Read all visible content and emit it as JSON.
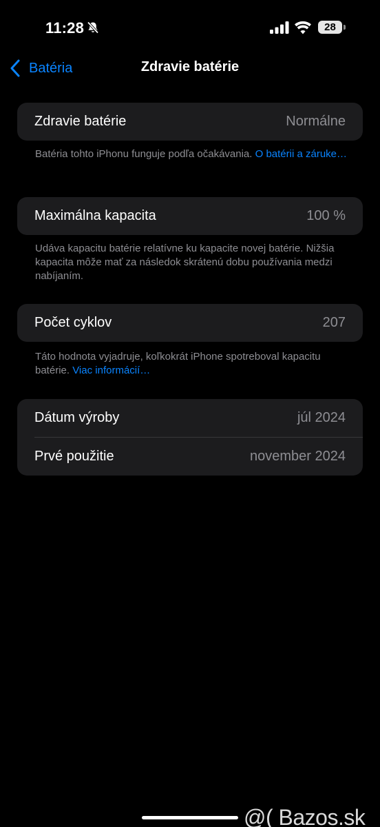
{
  "status_bar": {
    "time": "11:28",
    "battery_level": "28",
    "icons": [
      "bell-slash-icon",
      "cellular-signal-icon",
      "wifi-icon",
      "battery-icon"
    ]
  },
  "nav": {
    "back_label": "Batéria",
    "title": "Zdravie batérie"
  },
  "health": {
    "label": "Zdravie batérie",
    "value": "Normálne",
    "footnote_text": "Batéria tohto iPhonu funguje podľa očakávania. ",
    "footnote_link": "O batérii a záruke…"
  },
  "capacity": {
    "label": "Maximálna kapacita",
    "value": "100 %",
    "footnote_text": "Udáva kapacitu batérie relatívne ku kapacite novej batérie. Nižšia kapacita môže mať za následok skrátenú dobu používania medzi nabíjaním."
  },
  "cycles": {
    "label": "Počet cyklov",
    "value": "207",
    "footnote_text": "Táto hodnota vyjadruje, koľkokrát iPhone spotreboval kapacitu batérie. ",
    "footnote_link": "Viac informácií…"
  },
  "dates": {
    "manufacture_label": "Dátum výroby",
    "manufacture_value": "júl 2024",
    "first_use_label": "Prvé použitie",
    "first_use_value": "november 2024"
  },
  "watermark": "@( Bazos.sk",
  "colors": {
    "accent": "#0a84ff",
    "background": "#000000",
    "card": "#1c1c1e",
    "secondary_text": "#8e8e93"
  }
}
